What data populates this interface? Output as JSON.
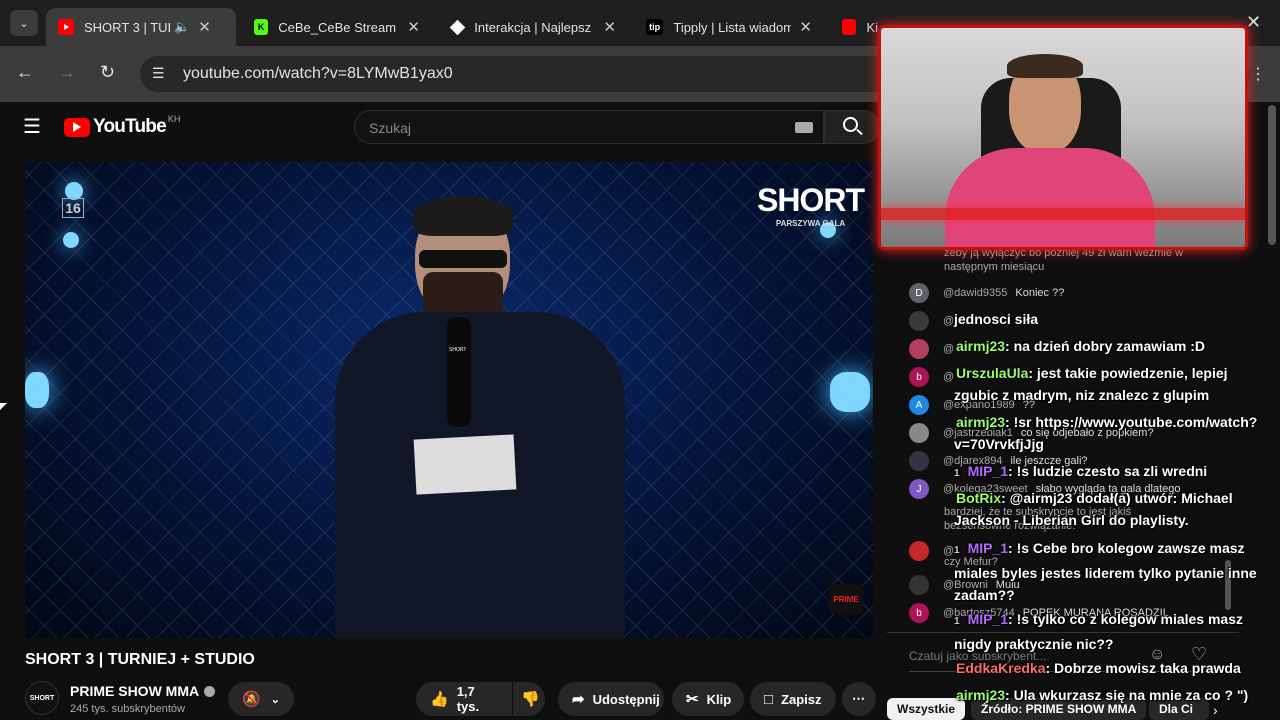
{
  "browser": {
    "tabs": [
      {
        "title": "SHORT 3 | TURN",
        "active": true,
        "favicon": "youtube-icon"
      },
      {
        "title": "CeBe_CeBe Stream",
        "active": false,
        "favicon": "kick-icon"
      },
      {
        "title": "Interakcja | Najlepsz",
        "active": false,
        "favicon": "diamond-icon"
      },
      {
        "title": "Tipply | Lista wiadom",
        "active": false,
        "favicon": "tip-icon"
      },
      {
        "title": "Ki",
        "active": false,
        "favicon": "youtube-icon"
      }
    ],
    "tip_favicon_text": "tip",
    "kick_favicon_text": "K",
    "url": "youtube.com/watch?v=8LYMwB1yax0"
  },
  "youtube": {
    "logo_text": "YouTube",
    "logo_region": "KH",
    "search_placeholder": "Szukaj",
    "video_title": "SHORT 3 | TURNIEJ + STUDIO",
    "channel_name": "PRIME SHOW MMA",
    "channel_logo_text": "SHORT",
    "subscribers": "245 tys. subskrybentów",
    "likes": "1,7 tys.",
    "share_label": "Udostępnij",
    "clip_label": "Klip",
    "save_label": "Zapisz",
    "video_overlay": {
      "logo": "SHORT",
      "logo_sub": "PARSZYWA GALA",
      "age_rating": "16",
      "mic_label": "SHORT",
      "corner_logo": "PRIME"
    }
  },
  "chat": {
    "top_text": "żeby ją wyłączyć bo później 49 zł wam weźmie w następnym miesiącu",
    "rows": [
      {
        "avatar": "D",
        "color": "#5f6368",
        "user": "@dawid9355",
        "text": "Koniec ??"
      },
      {
        "avatar": "",
        "color": "#3a3a3a",
        "user": "@",
        "text": "h"
      },
      {
        "avatar": "",
        "color": "#b04060",
        "user": "@",
        "text": ""
      },
      {
        "avatar": "b",
        "color": "#ad1457",
        "user": "@",
        "text": ""
      },
      {
        "avatar": "A",
        "color": "#1e88e5",
        "user": "@expano1989",
        "text": "??"
      },
      {
        "avatar": "",
        "color": "#888",
        "user": "@jastrzebiak1",
        "text": "co się odjebało z popkiem?"
      },
      {
        "avatar": "",
        "color": "#334",
        "user": "@djarex894",
        "text": "ile jeszcze gali?"
      },
      {
        "avatar": "J",
        "color": "#7e57c2",
        "user": "@kolega23sweet",
        "text": "słabo wygląda ta gala dlatego"
      },
      {
        "avatar": "",
        "color": "#c62828",
        "user": "@",
        "text": ""
      },
      {
        "avatar": "",
        "color": "#333",
        "user": "@Browni",
        "text": "Mulu"
      },
      {
        "avatar": "b",
        "color": "#ad1457",
        "user": "@bartosz5744",
        "text": "POPEK MURANA ROSADZIL"
      }
    ],
    "extra_lines": [
      "bardziej, że te subskrypcje to jest jakiś",
      "bezsensowne rozwiązanie.",
      "czy Mefur?"
    ],
    "input_placeholder": "Czatuj jako subskrybent...",
    "tabs": [
      "Wszystkie",
      "Źródło: PRIME SHOW MMA",
      "Dla Ci"
    ]
  },
  "overlay_chat": [
    {
      "user": "",
      "color": "#ffffff",
      "text": "jednosci siła"
    },
    {
      "user": "airmj23",
      "color": "#9bff6a",
      "text": ": na dzień dobry zamawiam :D"
    },
    {
      "user": "UrszulaUla",
      "color": "#9bff6a",
      "text": ": jest takie powiedzenie, lepiej zgubic z madrym, niz znalezc z glupim"
    },
    {
      "user": "airmj23",
      "color": "#9bff6a",
      "text": ": !sr https://www.youtube.com/watch?v=70VrvkfjJjg"
    },
    {
      "user": "MIP_1",
      "color": "#b36bff",
      "text": ": !s ludzie czesto sa zli wredni",
      "badge": "1"
    },
    {
      "user": "BotRix",
      "color": "#9bff6a",
      "text": ": @airmj23 dodał(a) utwór: Michael Jackson - Liberian Girl do playlisty."
    },
    {
      "user": "MIP_1",
      "color": "#b36bff",
      "text": ": !s Cebe bro kolegow zawsze masz miales byles jestes liderem tylko pytanie inne zadam??",
      "badge": "1"
    },
    {
      "user": "MIP_1",
      "color": "#b36bff",
      "text": ": !s tylko co z kolegow miales masz nigdy praktycznie nic??",
      "badge": "1"
    },
    {
      "user": "EddkaKredka",
      "color": "#ff6b6b",
      "text": ": Dobrze mowisz taka prawda"
    },
    {
      "user": "airmj23",
      "color": "#9bff6a",
      "text": ": Ula wkurzasz się na mnie za co ? \")"
    }
  ]
}
